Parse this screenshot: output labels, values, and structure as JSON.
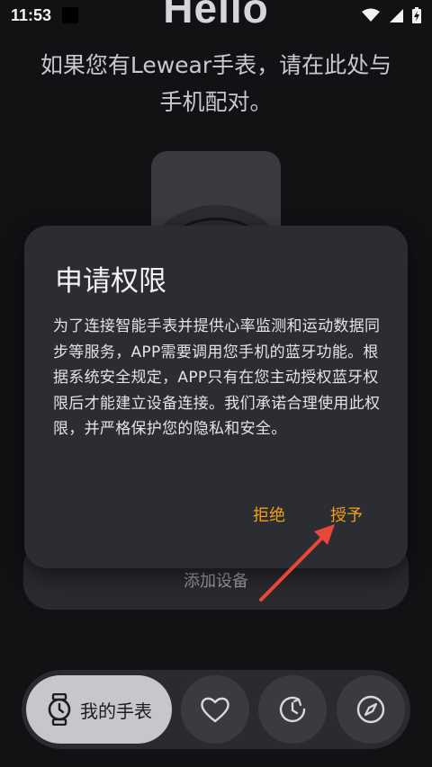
{
  "status_bar": {
    "time": "11:53",
    "icons": [
      "wifi-icon",
      "signal-icon",
      "battery-charging-icon"
    ]
  },
  "background": {
    "hello_title": "Hello",
    "pair_prompt_line1": "如果您有Lewear手表，请在此处与",
    "pair_prompt_line2": "手机配对。",
    "add_device_label": "添加设备"
  },
  "dialog": {
    "title": "申请权限",
    "body": "为了连接智能手表并提供心率监测和运动数据同步等服务，APP需要调用您手机的蓝牙功能。根据系统安全规定，APP只有在您主动授权蓝牙权限后才能建立设备连接。我们承诺合理使用此权限，并严格保护您的隐私和安全。",
    "deny_label": "拒绝",
    "grant_label": "授予",
    "accent_color": "#F2A20F"
  },
  "bottom_nav": {
    "active_label": "我的手表",
    "items": [
      {
        "name": "my-watch",
        "icon": "watch-icon",
        "active": true
      },
      {
        "name": "health",
        "icon": "heart-icon",
        "active": false
      },
      {
        "name": "activity",
        "icon": "clock-icon",
        "active": false
      },
      {
        "name": "discover",
        "icon": "compass-icon",
        "active": false
      }
    ]
  },
  "annotation": {
    "arrow_color": "#E8473A"
  }
}
